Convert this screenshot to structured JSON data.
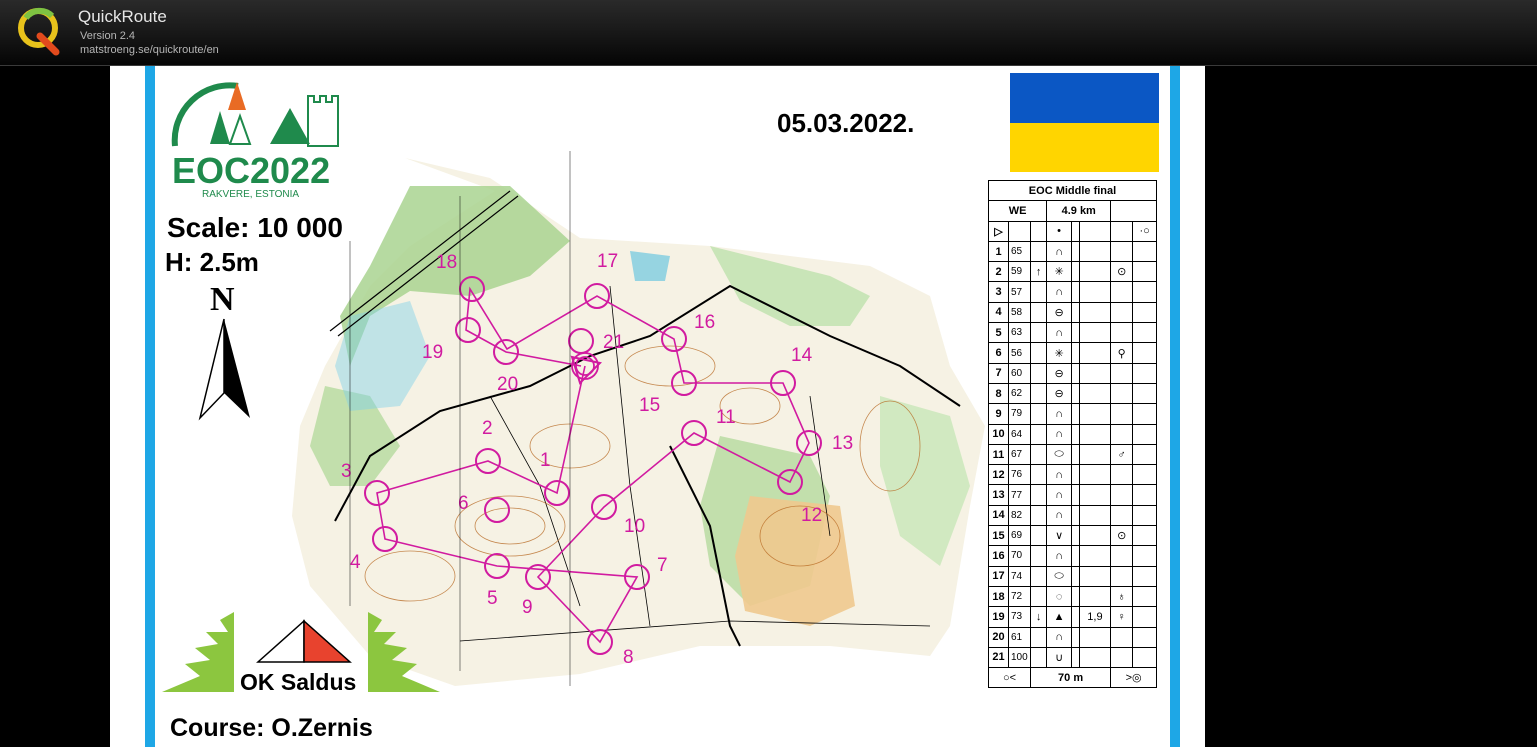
{
  "app": {
    "name": "QuickRoute",
    "version": "Version 2.4",
    "url": "matstroeng.se/quickroute/en"
  },
  "map": {
    "date": "05.03.2022.",
    "scale": "Scale: 10 000",
    "equidistance": "H: 2.5m",
    "north_label": "N",
    "course": "Course: O.Zernis",
    "club": "OK Saldus",
    "event_logo": {
      "main": "EOC2022",
      "sub": "RAKVERE, ESTONIA"
    },
    "flag_colors": [
      "#0b57c4",
      "#ffd500"
    ],
    "controls": [
      "1",
      "2",
      "3",
      "4",
      "5",
      "6",
      "7",
      "8",
      "9",
      "10",
      "11",
      "12",
      "13",
      "14",
      "15",
      "16",
      "17",
      "18",
      "19",
      "20",
      "21"
    ]
  },
  "description": {
    "title": "EOC Middle final",
    "category": "WE",
    "length": "4.9 km",
    "rows": [
      {
        "n": "1",
        "code": "65",
        "d": "∩",
        "x": ""
      },
      {
        "n": "2",
        "code": "59",
        "d": "✳",
        "x": "⊙",
        "dir": "↑"
      },
      {
        "n": "3",
        "code": "57",
        "d": "∩",
        "x": ""
      },
      {
        "n": "4",
        "code": "58",
        "d": "⊖",
        "x": ""
      },
      {
        "n": "5",
        "code": "63",
        "d": "∩",
        "x": ""
      },
      {
        "n": "6",
        "code": "56",
        "d": "✳",
        "x": "⚲"
      },
      {
        "n": "7",
        "code": "60",
        "d": "⊖",
        "x": ""
      },
      {
        "n": "8",
        "code": "62",
        "d": "⊖",
        "x": ""
      },
      {
        "n": "9",
        "code": "79",
        "d": "∩",
        "x": ""
      },
      {
        "n": "10",
        "code": "64",
        "d": "∩",
        "x": ""
      },
      {
        "n": "11",
        "code": "67",
        "d": "⬭",
        "x": "♂"
      },
      {
        "n": "12",
        "code": "76",
        "d": "∩",
        "x": ""
      },
      {
        "n": "13",
        "code": "77",
        "d": "∩",
        "x": ""
      },
      {
        "n": "14",
        "code": "82",
        "d": "∩",
        "x": ""
      },
      {
        "n": "15",
        "code": "69",
        "d": "∨",
        "x": "⊙"
      },
      {
        "n": "16",
        "code": "70",
        "d": "∩",
        "x": ""
      },
      {
        "n": "17",
        "code": "74",
        "d": "⬭",
        "x": ""
      },
      {
        "n": "18",
        "code": "72",
        "d": "◌",
        "x": "♁"
      },
      {
        "n": "19",
        "code": "73",
        "d": "▲",
        "x": "♀",
        "dir": "↓",
        "size": "1,9"
      },
      {
        "n": "20",
        "code": "61",
        "d": "∩",
        "x": ""
      },
      {
        "n": "21",
        "code": "100",
        "d": "∪",
        "x": ""
      }
    ],
    "finish": "70 m"
  }
}
